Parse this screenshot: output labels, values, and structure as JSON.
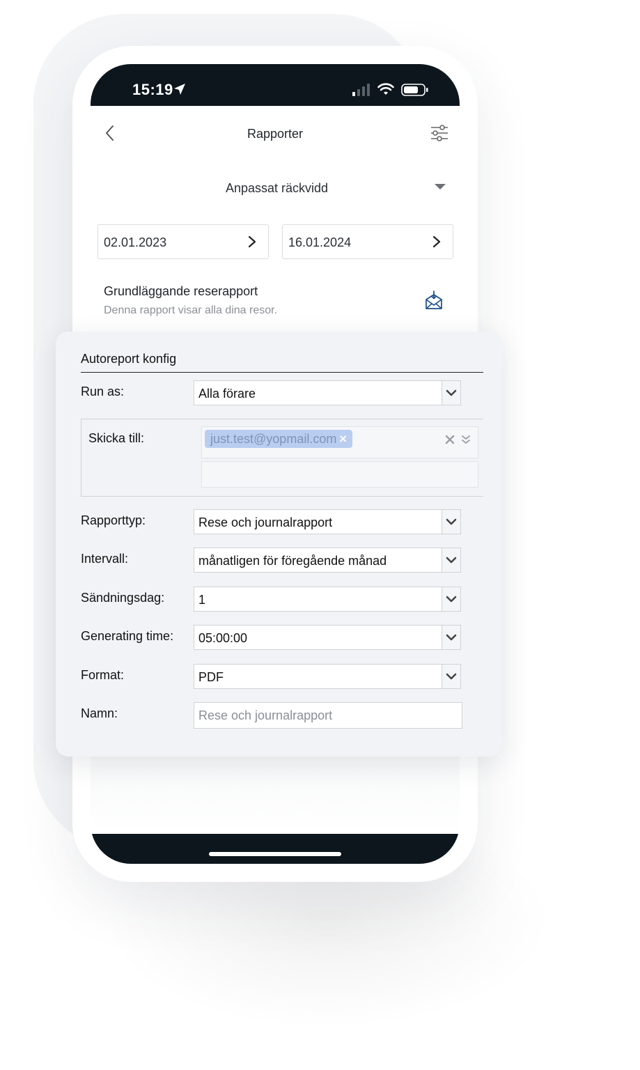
{
  "status_bar": {
    "time": "15:19"
  },
  "header": {
    "title": "Rapporter"
  },
  "range": {
    "selected": "Anpassat räckvidd"
  },
  "dates": {
    "start": "02.01.2023",
    "end": "16.01.2024"
  },
  "report": {
    "title": "Grundläggande reserapport",
    "description": "Denna rapport visar alla dina resor."
  },
  "autoreport": {
    "title": "Autoreport konfig",
    "run_as": {
      "label": "Run as:",
      "value": "Alla förare"
    },
    "send_to": {
      "label": "Skicka till:",
      "tags": [
        "just.test@yopmail.com"
      ]
    },
    "report_type": {
      "label": "Rapporttyp:",
      "value": "Rese och journalrapport"
    },
    "interval": {
      "label": "Intervall:",
      "value": "månatligen för föregående månad"
    },
    "send_day": {
      "label": "Sändningsdag:",
      "value": "1"
    },
    "generating_time": {
      "label": "Generating time:",
      "value": "05:00:00"
    },
    "format": {
      "label": "Format:",
      "value": "PDF"
    },
    "name": {
      "label": "Namn:",
      "placeholder": "Rese och journalrapport"
    }
  },
  "icons": {
    "status": [
      "location-arrow-icon",
      "signal-icon",
      "wifi-icon",
      "battery-icon"
    ],
    "header": [
      "back-chevron-icon",
      "filter-sliders-icon"
    ],
    "report": "mail-download-icon"
  },
  "colors": {
    "statusbar_bg": "#0d161d",
    "panel_bg": "#f1f3f6",
    "tag_bg": "#b9cdf0",
    "accent_icon": "#1b4f8a"
  }
}
